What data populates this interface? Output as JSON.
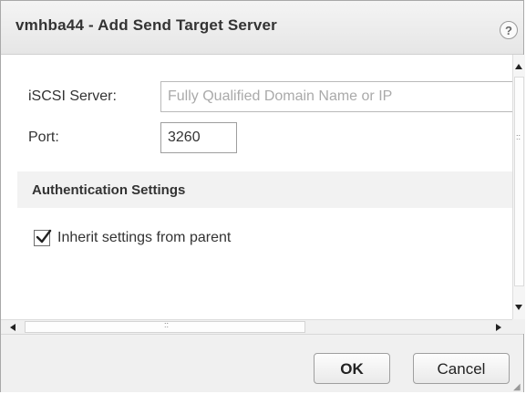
{
  "dialog": {
    "title": "vmhba44 - Add Send Target Server",
    "help_icon": "?"
  },
  "form": {
    "server_label": "iSCSI Server:",
    "server_placeholder": "Fully Qualified Domain Name or IP",
    "port_label": "Port:",
    "port_value": "3260"
  },
  "auth": {
    "section_title": "Authentication Settings",
    "inherit_label": "Inherit settings from parent",
    "inherit_checked": true
  },
  "scrollbar": {
    "grip": "::"
  },
  "footer": {
    "ok_label": "OK",
    "cancel_label": "Cancel"
  }
}
